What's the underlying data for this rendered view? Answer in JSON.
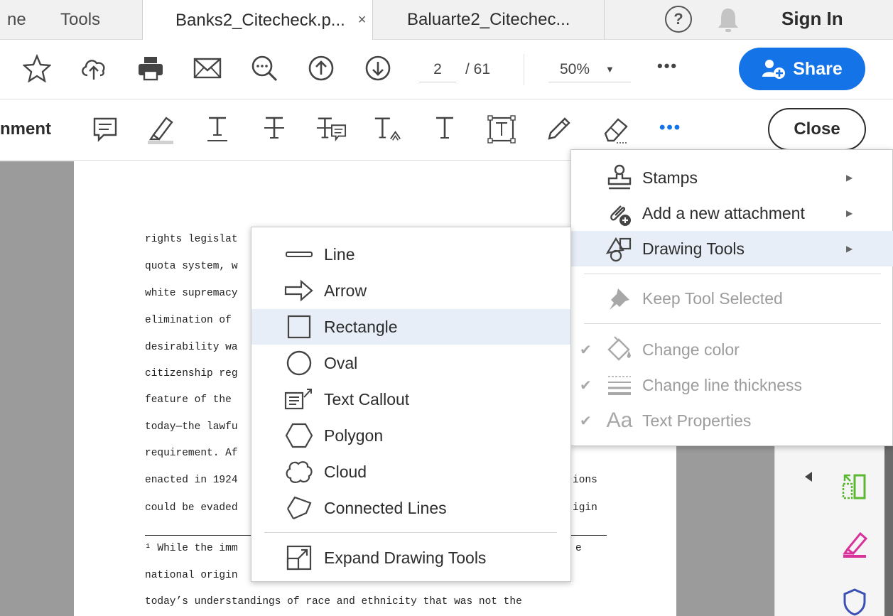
{
  "tabs": {
    "home_partial": "ne",
    "tools": "Tools",
    "doc1": "Banks2_Citecheck.p...",
    "doc1_close": "×",
    "doc2": "Baluarte2_Citechec...",
    "sign_in": "Sign In",
    "help": "?"
  },
  "toolbar": {
    "page_current": "2",
    "page_total": "/ 61",
    "zoom": "50%",
    "zoom_caret": "▼",
    "more": "•••",
    "share": "Share"
  },
  "comment_toolbar": {
    "label": "nment",
    "more": "•••",
    "close": "Close"
  },
  "document": {
    "lines": [
      "rights legislat",
      "quota system, w",
      "white supremacy",
      "elimination of",
      "desirability wa",
      "citizenship reg",
      "feature of the",
      "today—the lawfu",
      "requirement. Af",
      "enacted in 1924",
      "could be evaded"
    ],
    "right_fragments": [
      "ions",
      "igin"
    ],
    "footnote_lines": [
      "¹ While the imm",
      "national origin",
      "today’s understandings of race and ethnicity that was not the"
    ],
    "footnote_right": "e"
  },
  "main_menu": {
    "items": [
      {
        "label": "Stamps",
        "icon": "stamp-icon",
        "submenu": true,
        "enabled": true
      },
      {
        "label": "Add a new attachment",
        "icon": "attachment-icon",
        "submenu": true,
        "enabled": true
      },
      {
        "label": "Drawing Tools",
        "icon": "drawing-tools-icon",
        "submenu": true,
        "enabled": true,
        "highlighted": true
      },
      {
        "label": "Keep Tool Selected",
        "icon": "pin-icon",
        "enabled": false
      },
      {
        "label": "Change color",
        "icon": "paint-bucket-icon",
        "enabled": false,
        "checked": true
      },
      {
        "label": "Change line thickness",
        "icon": "line-thickness-icon",
        "enabled": false,
        "checked": true
      },
      {
        "label": "Text Properties",
        "icon": "text-properties-icon",
        "enabled": false,
        "checked": true
      }
    ],
    "arrow": "▶",
    "check": "✔",
    "aa": "Aa"
  },
  "drawing_menu": {
    "items": [
      {
        "label": "Line",
        "icon": "line-icon"
      },
      {
        "label": "Arrow",
        "icon": "arrow-icon"
      },
      {
        "label": "Rectangle",
        "icon": "rectangle-icon",
        "highlighted": true
      },
      {
        "label": "Oval",
        "icon": "oval-icon"
      },
      {
        "label": "Text Callout",
        "icon": "text-callout-icon"
      },
      {
        "label": "Polygon",
        "icon": "polygon-icon"
      },
      {
        "label": "Cloud",
        "icon": "cloud-icon"
      },
      {
        "label": "Connected Lines",
        "icon": "connected-lines-icon"
      },
      {
        "label": "Expand Drawing Tools",
        "icon": "expand-icon"
      }
    ]
  },
  "colors": {
    "accent": "#1473e6",
    "menu_highlight": "#e8eef7",
    "disabled_text": "#9c9c9c",
    "doc_bg": "#9b9b9b",
    "green_tool": "#5cb833",
    "pink_tool": "#d9329b",
    "shield_tool": "#3b4fb5"
  }
}
